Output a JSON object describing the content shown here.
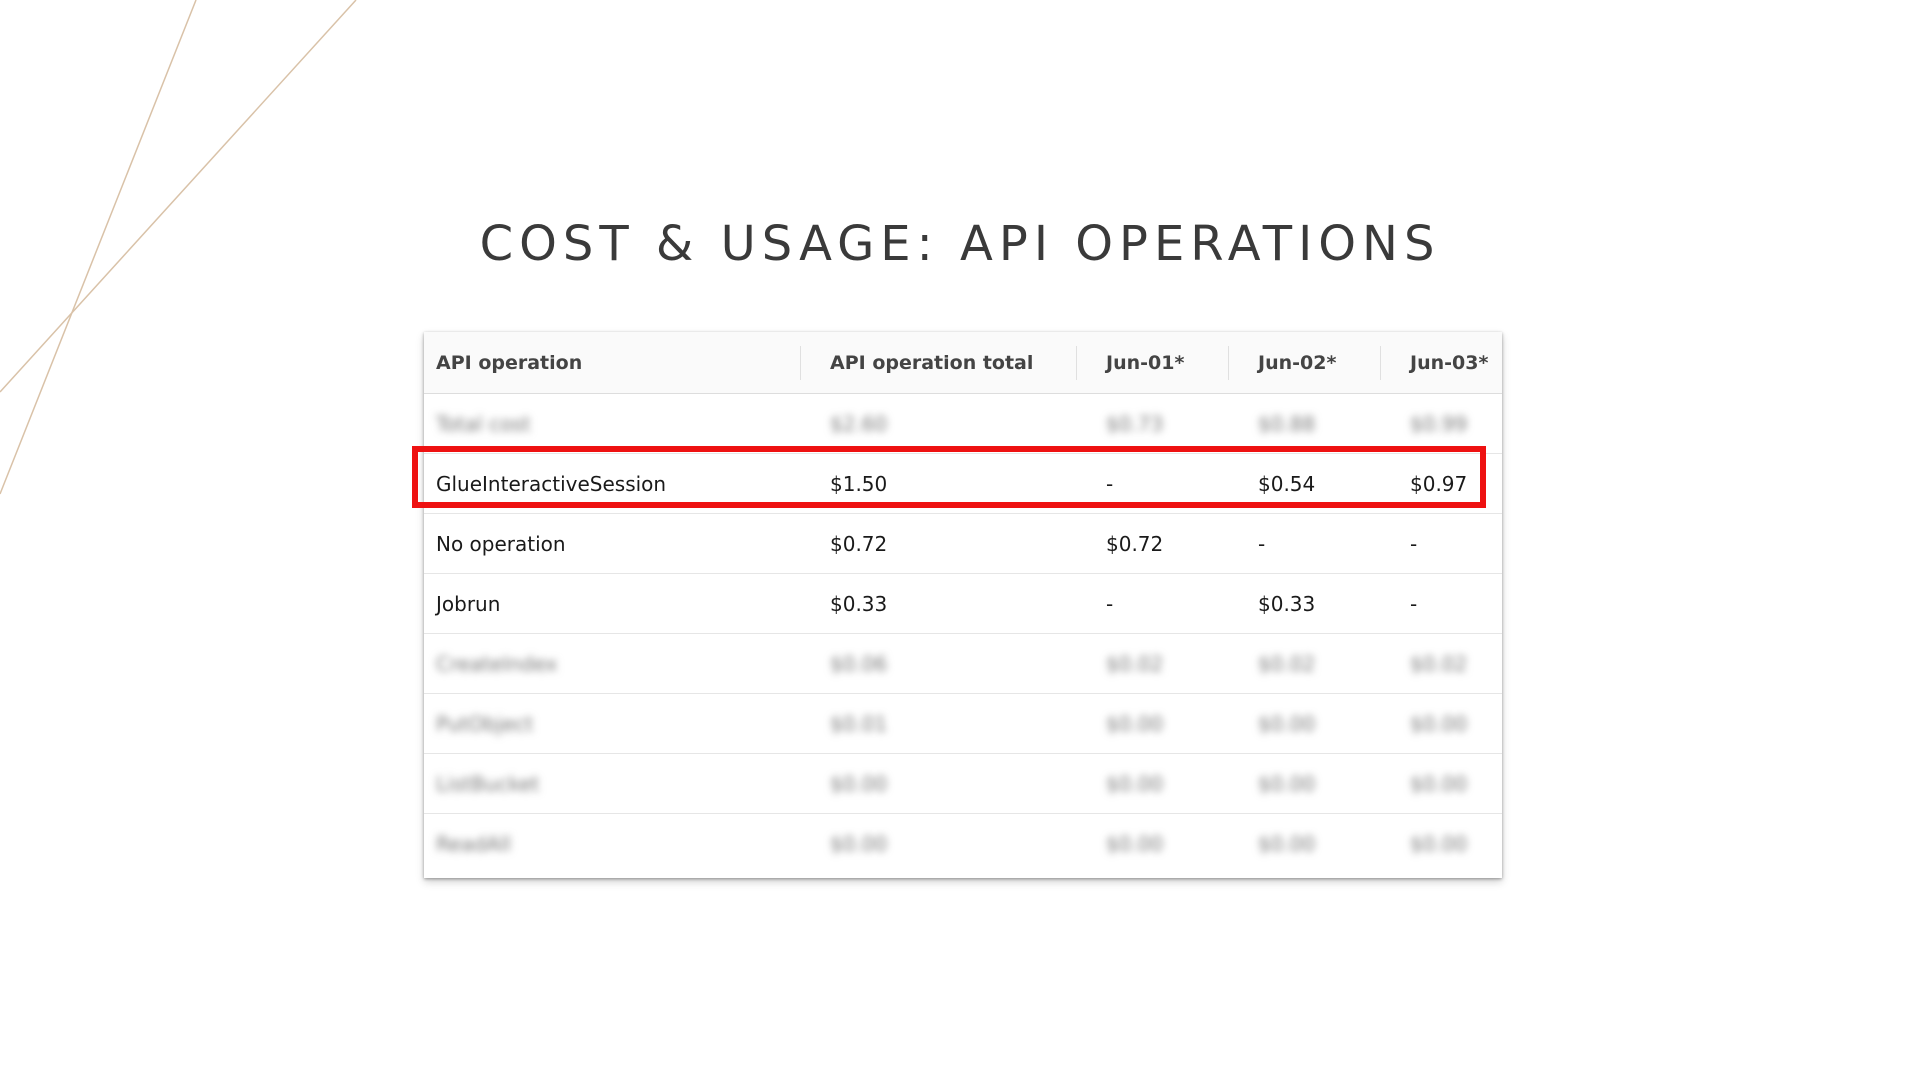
{
  "slide": {
    "title": "COST & USAGE: API OPERATIONS"
  },
  "colors": {
    "highlight": "#ee1111",
    "title": "#3a3a3a",
    "deco_line": "#d9c2a8"
  },
  "table": {
    "columns": [
      "API operation",
      "API operation total",
      "Jun-01*",
      "Jun-02*",
      "Jun-03*"
    ],
    "rows": [
      {
        "cells": [
          "Total cost",
          "$2.60",
          "$0.73",
          "$0.88",
          "$0.99"
        ],
        "blurred": true,
        "highlighted": false
      },
      {
        "cells": [
          "GlueInteractiveSession",
          "$1.50",
          "-",
          "$0.54",
          "$0.97"
        ],
        "blurred": false,
        "highlighted": true
      },
      {
        "cells": [
          "No operation",
          "$0.72",
          "$0.72",
          "-",
          "-"
        ],
        "blurred": false,
        "highlighted": false
      },
      {
        "cells": [
          "Jobrun",
          "$0.33",
          "-",
          "$0.33",
          "-"
        ],
        "blurred": false,
        "highlighted": false
      },
      {
        "cells": [
          "CreateIndex",
          "$0.06",
          "$0.02",
          "$0.02",
          "$0.02"
        ],
        "blurred": true,
        "highlighted": false
      },
      {
        "cells": [
          "PutObject",
          "$0.01",
          "$0.00",
          "$0.00",
          "$0.00"
        ],
        "blurred": true,
        "highlighted": false
      },
      {
        "cells": [
          "ListBucket",
          "$0.00",
          "$0.00",
          "$0.00",
          "$0.00"
        ],
        "blurred": true,
        "highlighted": false
      },
      {
        "cells": [
          "ReadAll",
          "$0.00",
          "$0.00",
          "$0.00",
          "$0.00"
        ],
        "blurred": true,
        "highlighted": false
      }
    ]
  }
}
